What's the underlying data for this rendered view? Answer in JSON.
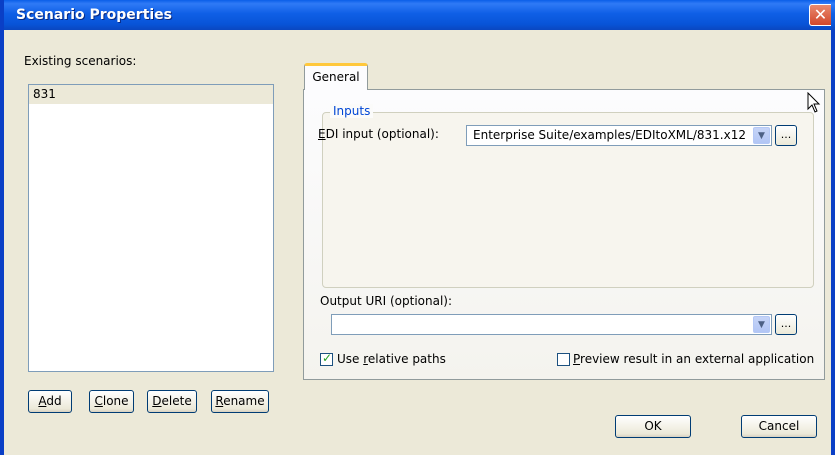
{
  "window": {
    "title": "Scenario Properties",
    "close_glyph": "✕"
  },
  "scenarios": {
    "label": "Existing scenarios:",
    "items": [
      "831"
    ]
  },
  "buttons": {
    "add": {
      "accel": "A",
      "rest": "dd"
    },
    "clone": {
      "accel": "C",
      "rest": "lone"
    },
    "delete": {
      "accel": "D",
      "rest": "elete"
    },
    "rename": {
      "accel": "R",
      "rest": "ename"
    },
    "ok": "OK",
    "cancel": "Cancel"
  },
  "tabs": [
    {
      "label": "General",
      "selected": true
    }
  ],
  "inputs_group": {
    "legend": "Inputs",
    "edi_label_accel": "E",
    "edi_label_rest": "DI input (optional):",
    "edi_value": "Enterprise Suite/examples/EDItoXML/831.x12",
    "browse_label": "..."
  },
  "output": {
    "label": "Output URI (optional):",
    "value": "",
    "browse_label": "..."
  },
  "options": {
    "relative_paths": {
      "pre": "Use ",
      "accel": "r",
      "rest": "elative paths",
      "checked": true
    },
    "preview": {
      "accel": "P",
      "rest": "review result in an external application",
      "checked": false
    }
  },
  "icons": {
    "dropdown": "▼",
    "check": "✓"
  },
  "colors": {
    "titlebar": "#0a5ee8",
    "tab_accent": "#ffc83c",
    "group_legend": "#0046d5"
  }
}
